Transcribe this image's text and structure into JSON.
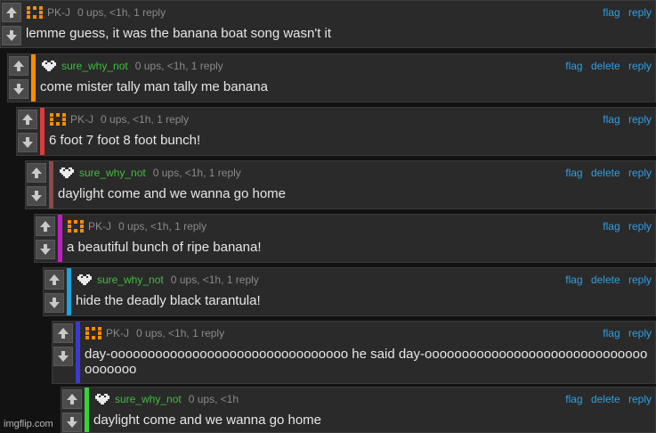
{
  "colors": {
    "bars": [
      "#ff8c00",
      "#e03a3a",
      "#8a4a4a",
      "#c21fc2",
      "#1aa4e0",
      "#3a3ad0",
      "#3ad03a"
    ],
    "link": "#2ea0e6",
    "username_sure": "#3fbf3f"
  },
  "icons": {
    "upvote": "arrow-up-icon",
    "downvote": "arrow-down-icon"
  },
  "comments": [
    {
      "user": "PK-J",
      "stats": "0 ups, <1h, 1 reply",
      "actions": [
        "flag",
        "reply"
      ],
      "text": "lemme guess, it was the banana boat song wasn't it"
    },
    {
      "user": "sure_why_not",
      "stats": "0 ups, <1h, 1 reply",
      "actions": [
        "flag",
        "delete",
        "reply"
      ],
      "text": "come mister tally man tally me banana"
    },
    {
      "user": "PK-J",
      "stats": "0 ups, <1h, 1 reply",
      "actions": [
        "flag",
        "reply"
      ],
      "text": "6 foot 7 foot 8 foot bunch!"
    },
    {
      "user": "sure_why_not",
      "stats": "0 ups, <1h, 1 reply",
      "actions": [
        "flag",
        "delete",
        "reply"
      ],
      "text": "daylight come and we wanna go home"
    },
    {
      "user": "PK-J",
      "stats": "0 ups, <1h, 1 reply",
      "actions": [
        "flag",
        "reply"
      ],
      "text": "a beautiful bunch of ripe banana!"
    },
    {
      "user": "sure_why_not",
      "stats": "0 ups, <1h, 1 reply",
      "actions": [
        "flag",
        "delete",
        "reply"
      ],
      "text": "hide the deadly black tarantula!"
    },
    {
      "user": "PK-J",
      "stats": "0 ups, <1h, 1 reply",
      "actions": [
        "flag",
        "reply"
      ],
      "text": "day-oooooooooooooooooooooooooooooooo he said day-ooooooooooooooooooooooooooooooooooooo"
    },
    {
      "user": "sure_why_not",
      "stats": "0 ups, <1h",
      "actions": [
        "flag",
        "delete",
        "reply"
      ],
      "text": "daylight come and we wanna go home"
    }
  ],
  "watermark": "imgflip.com"
}
